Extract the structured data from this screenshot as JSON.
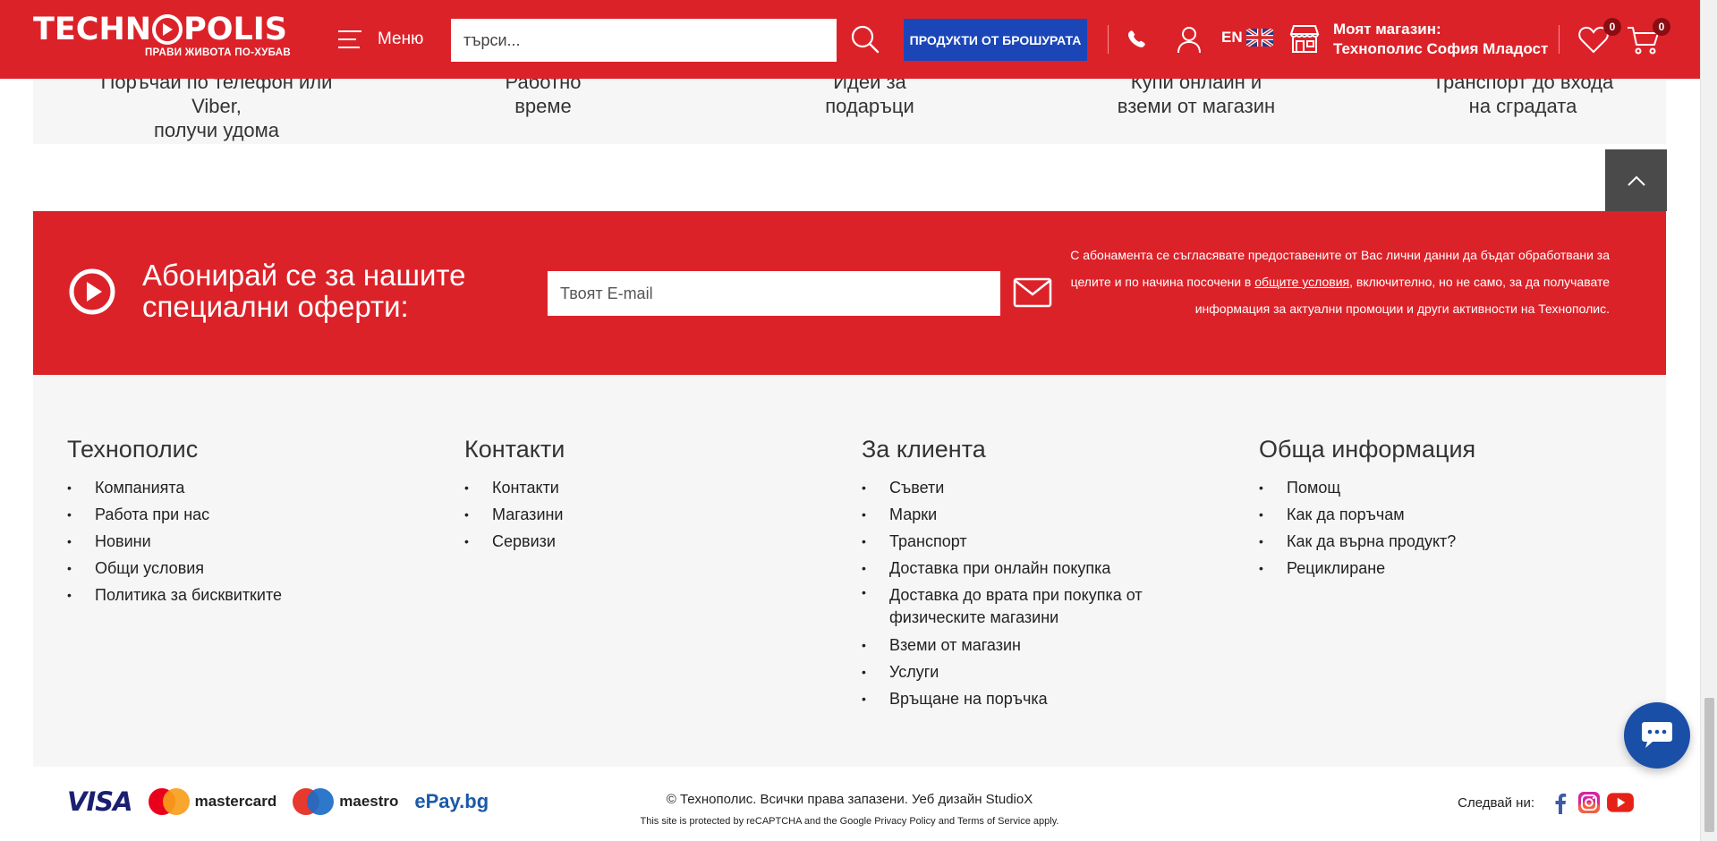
{
  "header": {
    "logo": "TECHNOPOLIS",
    "logo_left": "TECHN",
    "logo_right": "POLIS",
    "tagline": "ПРАВИ ЖИВОТА ПО-ХУБАВ",
    "menu_label": "Меню",
    "search_placeholder": "търси...",
    "brochure_label": "ПРОДУКТИ ОТ БРОШУРАТА",
    "lang_label": "EN",
    "store_label": "Моят магазин:",
    "store_name": "Технополис София Младост",
    "wishlist_count": "0",
    "cart_count": "0"
  },
  "features": [
    {
      "line1": "Поръчай по телефон или Viber,",
      "line2": "получи удома"
    },
    {
      "line1": "Работно",
      "line2": "време"
    },
    {
      "line1": "Идеи за",
      "line2": "подаръци"
    },
    {
      "line1": "Купи онлайн и",
      "line2": "вземи от магазин"
    },
    {
      "line1": "Транспорт до входа",
      "line2": "на сградата"
    }
  ],
  "newsletter": {
    "title_line1": "Абонирай се за нашите",
    "title_line2": "специални оферти:",
    "email_placeholder": "Твоят E-mail",
    "note_part1": "С абонамента се съгласявате предоставените от Вас лични данни да бъдат обработвани за целите и по начина посочени в ",
    "note_link": "общите условия",
    "note_part2": ", включително, но не само, за да получавате информация за актуални промоции и други активности на Технополис."
  },
  "footer": {
    "columns": [
      {
        "title": "Технополис",
        "items": [
          "Компанията",
          "Работа при нас",
          "Новини",
          "Общи условия",
          "Политика за бисквитките"
        ]
      },
      {
        "title": "Контакти",
        "items": [
          "Контакти",
          "Магазини",
          "Сервизи"
        ]
      },
      {
        "title": "За клиента",
        "items": [
          "Съвети",
          "Марки",
          "Транспорт",
          "Доставка при онлайн покупка",
          "Доставка до врата при покупка от физическите магазини",
          "Вземи от магазин",
          "Услуги",
          "Връщане на поръчка"
        ]
      },
      {
        "title": "Обща информация",
        "items": [
          "Помощ",
          "Как да поръчам",
          "Как да върна продукт?",
          "Рециклиране"
        ]
      }
    ]
  },
  "bottom": {
    "payments": {
      "visa": "VISA",
      "mastercard": "mastercard",
      "maestro": "maestro",
      "epay": "ePay.bg"
    },
    "copyright": "© Технополис. Всички права запазени. Уеб дизайн StudioX",
    "recaptcha_prefix": "This site is protected by reCAPTCHA and the Google ",
    "privacy_label": "Privacy Policy",
    "and_label": " and ",
    "terms_label": "Terms of Service",
    "recaptcha_suffix": " apply.",
    "follow_label": "Следвай ни:",
    "social_icons": [
      "facebook-icon",
      "instagram-icon",
      "youtube-icon"
    ]
  },
  "colors": {
    "brand_red": "#dc2229",
    "brochure_blue": "#1a46b8",
    "chat_blue": "#1a4fa8",
    "scrolltop_gray": "#4a4a4a",
    "footer_bg": "#f6f6f6"
  }
}
